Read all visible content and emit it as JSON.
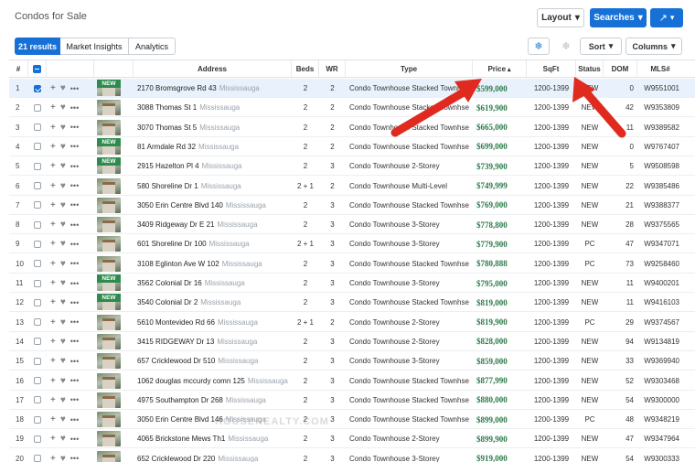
{
  "app": {
    "title": "Condos for Sale"
  },
  "toolbar": {
    "layout_label": "Layout",
    "searches_label": "Searches",
    "sort_label": "Sort",
    "columns_label": "Columns"
  },
  "tabs": [
    {
      "label": "21 results",
      "active": true
    },
    {
      "label": "Market Insights",
      "active": false
    },
    {
      "label": "Analytics",
      "active": false
    }
  ],
  "icons": {
    "chevron": "▾",
    "share": "↗",
    "snowflake": "❄",
    "heart": "♥",
    "plus": "+",
    "dots": "•••"
  },
  "columns": {
    "num": "#",
    "address": "Address",
    "beds": "Beds",
    "wr": "WR",
    "type": "Type",
    "price": "Price",
    "sort_indicator": "▴",
    "sqft": "SqFt",
    "status": "Status",
    "dom": "DOM",
    "mls": "MLS#"
  },
  "new_badge": "NEW",
  "rows": [
    {
      "num": "1",
      "address": "2170 Bromsgrove Rd 43",
      "city": "Mississauga",
      "beds": "2",
      "wr": "2",
      "type": "Condo Townhouse Stacked Townhse",
      "price": "$599,000",
      "sqft": "1200-1399",
      "status": "NEW",
      "dom": "0",
      "mls": "W9551001"
    },
    {
      "num": "2",
      "address": "3088 Thomas St 1",
      "city": "Mississauga",
      "beds": "2",
      "wr": "2",
      "type": "Condo Townhouse Stacked Townhse",
      "price": "$619,900",
      "sqft": "1200-1399",
      "status": "NEW",
      "dom": "42",
      "mls": "W9353809"
    },
    {
      "num": "3",
      "address": "3070 Thomas St 5",
      "city": "Mississauga",
      "beds": "2",
      "wr": "2",
      "type": "Condo Townhouse Stacked Townhse",
      "price": "$665,000",
      "sqft": "1200-1399",
      "status": "NEW",
      "dom": "11",
      "mls": "W9389582"
    },
    {
      "num": "4",
      "address": "81 Armdale Rd 32",
      "city": "Mississauga",
      "beds": "2",
      "wr": "2",
      "type": "Condo Townhouse Stacked Townhse",
      "price": "$699,000",
      "sqft": "1200-1399",
      "status": "NEW",
      "dom": "0",
      "mls": "W9767407"
    },
    {
      "num": "5",
      "address": "2915 Hazelton Pl 4",
      "city": "Mississauga",
      "beds": "2",
      "wr": "3",
      "type": "Condo Townhouse 2-Storey",
      "price": "$739,900",
      "sqft": "1200-1399",
      "status": "NEW",
      "dom": "5",
      "mls": "W9508598"
    },
    {
      "num": "6",
      "address": "580 Shoreline Dr 1",
      "city": "Mississauga",
      "beds": "2 + 1",
      "wr": "2",
      "type": "Condo Townhouse Multi-Level",
      "price": "$749,999",
      "sqft": "1200-1399",
      "status": "NEW",
      "dom": "22",
      "mls": "W9385486"
    },
    {
      "num": "7",
      "address": "3050 Erin Centre Blvd 140",
      "city": "Mississauga",
      "beds": "2",
      "wr": "3",
      "type": "Condo Townhouse Stacked Townhse",
      "price": "$769,000",
      "sqft": "1200-1399",
      "status": "NEW",
      "dom": "21",
      "mls": "W9388377"
    },
    {
      "num": "8",
      "address": "3409 Ridgeway Dr E 21",
      "city": "Mississauga",
      "beds": "2",
      "wr": "3",
      "type": "Condo Townhouse 3-Storey",
      "price": "$778,800",
      "sqft": "1200-1399",
      "status": "NEW",
      "dom": "28",
      "mls": "W9375565"
    },
    {
      "num": "9",
      "address": "601 Shoreline Dr 100",
      "city": "Mississauga",
      "beds": "2 + 1",
      "wr": "3",
      "type": "Condo Townhouse 3-Storey",
      "price": "$779,900",
      "sqft": "1200-1399",
      "status": "PC",
      "dom": "47",
      "mls": "W9347071"
    },
    {
      "num": "10",
      "address": "3108 Eglinton Ave W 102",
      "city": "Mississauga",
      "beds": "2",
      "wr": "3",
      "type": "Condo Townhouse Stacked Townhse",
      "price": "$780,888",
      "sqft": "1200-1399",
      "status": "PC",
      "dom": "73",
      "mls": "W9258460"
    },
    {
      "num": "11",
      "address": "3562 Colonial Dr 16",
      "city": "Mississauga",
      "beds": "2",
      "wr": "3",
      "type": "Condo Townhouse 3-Storey",
      "price": "$795,000",
      "sqft": "1200-1399",
      "status": "NEW",
      "dom": "11",
      "mls": "W9400201"
    },
    {
      "num": "12",
      "address": "3540 Colonial Dr 2",
      "city": "Mississauga",
      "beds": "2",
      "wr": "3",
      "type": "Condo Townhouse Stacked Townhse",
      "price": "$819,000",
      "sqft": "1200-1399",
      "status": "NEW",
      "dom": "11",
      "mls": "W9416103"
    },
    {
      "num": "13",
      "address": "5610 Montevideo Rd 66",
      "city": "Mississauga",
      "beds": "2 + 1",
      "wr": "2",
      "type": "Condo Townhouse 2-Storey",
      "price": "$819,900",
      "sqft": "1200-1399",
      "status": "PC",
      "dom": "29",
      "mls": "W9374567"
    },
    {
      "num": "14",
      "address": "3415 RIDGEWAY Dr 13",
      "city": "Mississauga",
      "beds": "2",
      "wr": "3",
      "type": "Condo Townhouse 2-Storey",
      "price": "$828,000",
      "sqft": "1200-1399",
      "status": "NEW",
      "dom": "94",
      "mls": "W9134819"
    },
    {
      "num": "15",
      "address": "657 Cricklewood Dr 510",
      "city": "Mississauga",
      "beds": "2",
      "wr": "3",
      "type": "Condo Townhouse 3-Storey",
      "price": "$859,000",
      "sqft": "1200-1399",
      "status": "NEW",
      "dom": "33",
      "mls": "W9369940"
    },
    {
      "num": "16",
      "address": "1062 douglas mccurdy comn 125",
      "city": "Mississauga",
      "beds": "2",
      "wr": "3",
      "type": "Condo Townhouse Stacked Townhse",
      "price": "$877,990",
      "sqft": "1200-1399",
      "status": "NEW",
      "dom": "52",
      "mls": "W9303468"
    },
    {
      "num": "17",
      "address": "4975 Southampton Dr 268",
      "city": "Mississauga",
      "beds": "2",
      "wr": "3",
      "type": "Condo Townhouse Stacked Townhse",
      "price": "$880,000",
      "sqft": "1200-1399",
      "status": "NEW",
      "dom": "54",
      "mls": "W9300000"
    },
    {
      "num": "18",
      "address": "3050 Erin Centre Blvd 146",
      "city": "Mississauga",
      "beds": "2",
      "wr": "3",
      "type": "Condo Townhouse Stacked Townhse",
      "price": "$899,000",
      "sqft": "1200-1399",
      "status": "PC",
      "dom": "48",
      "mls": "W9348219"
    },
    {
      "num": "19",
      "address": "4065 Brickstone Mews Th1",
      "city": "Mississauga",
      "beds": "2",
      "wr": "3",
      "type": "Condo Townhouse 2-Storey",
      "price": "$899,900",
      "sqft": "1200-1399",
      "status": "NEW",
      "dom": "47",
      "mls": "W9347964"
    },
    {
      "num": "20",
      "address": "652 Cricklewood Dr 220",
      "city": "Mississauga",
      "beds": "2",
      "wr": "3",
      "type": "Condo Townhouse 3-Storey",
      "price": "$919,000",
      "sqft": "1200-1399",
      "status": "NEW",
      "dom": "54",
      "mls": "W9300333"
    }
  ],
  "watermark": "HOUSEREALTY.COM"
}
